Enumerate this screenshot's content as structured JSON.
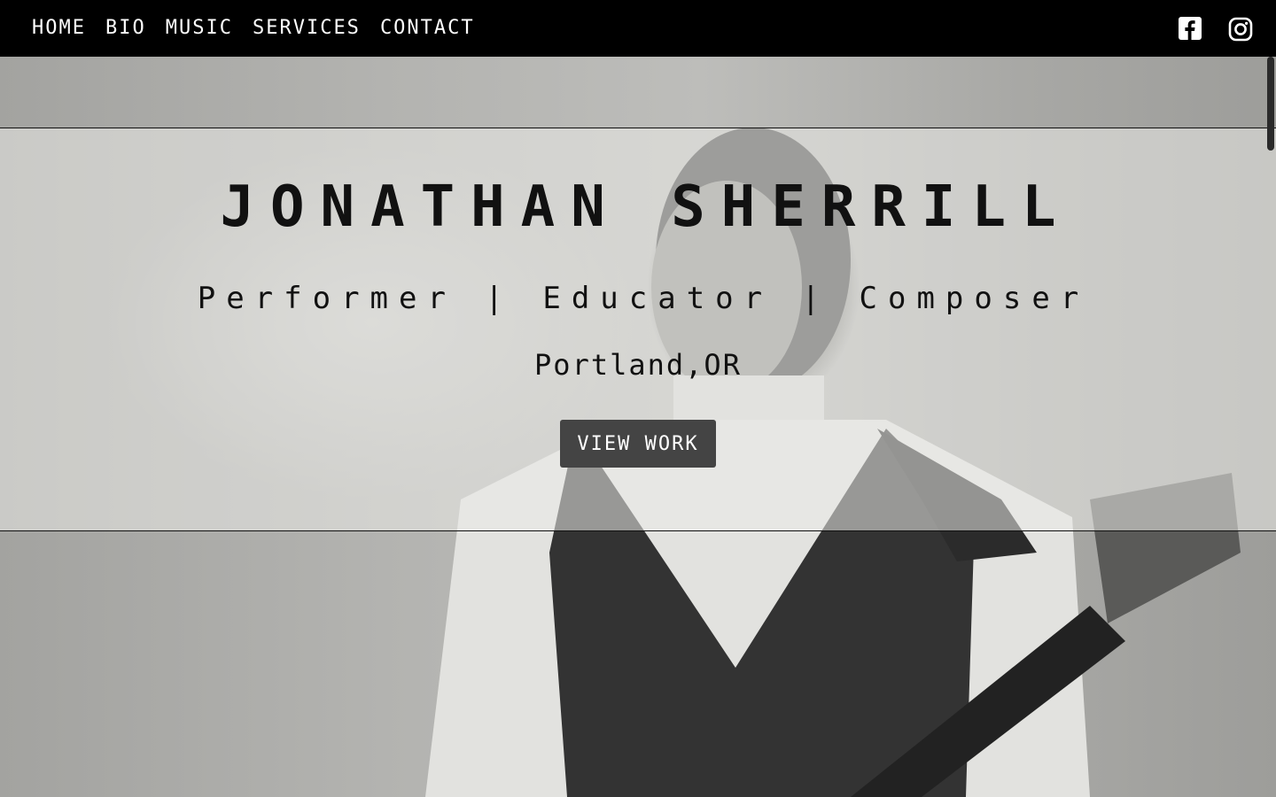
{
  "nav": {
    "items": [
      {
        "label": "HOME"
      },
      {
        "label": "BIO"
      },
      {
        "label": "MUSIC"
      },
      {
        "label": "SERVICES"
      },
      {
        "label": "CONTACT"
      }
    ],
    "social": [
      {
        "icon": "facebook-icon"
      },
      {
        "icon": "instagram-icon"
      }
    ]
  },
  "hero": {
    "name": "JONATHAN SHERRILL",
    "roles": "Performer | Educator | Composer",
    "location": "Portland,OR",
    "cta_label": "VIEW WORK"
  },
  "colors": {
    "nav_bg": "#000000",
    "nav_text": "#ffffff",
    "button_bg": "#444444",
    "text": "#111111"
  }
}
